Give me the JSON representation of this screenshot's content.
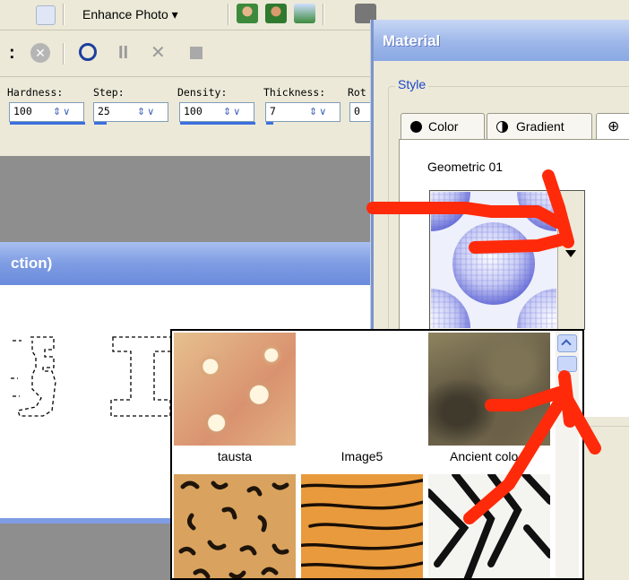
{
  "top_toolbar": {
    "enhance_label": "Enhance Photo ▾"
  },
  "tool_options": {
    "fields": [
      {
        "label": "Hardness:",
        "value": "100"
      },
      {
        "label": "Step:",
        "value": "25"
      },
      {
        "label": "Density:",
        "value": "100"
      },
      {
        "label": "Thickness:",
        "value": "7"
      },
      {
        "label": "Rot",
        "value": "0"
      }
    ]
  },
  "document": {
    "title_fragment": "ction)"
  },
  "material_dialog": {
    "title": "Material",
    "style_group_label": "Style",
    "tabs": [
      {
        "label": "Color"
      },
      {
        "label": "Gradient"
      }
    ],
    "pattern_name": "Geometric 01"
  },
  "pattern_picker": {
    "items": [
      {
        "label": "tausta"
      },
      {
        "label": "Image5"
      },
      {
        "label": "Ancient colo..."
      },
      {
        "label": ""
      },
      {
        "label": ""
      },
      {
        "label": ""
      }
    ]
  },
  "colors": {
    "accent_red": "#ff2a0a",
    "titlebar_blue": "#7e9ce3",
    "selection_blue": "#3c6fe0"
  }
}
